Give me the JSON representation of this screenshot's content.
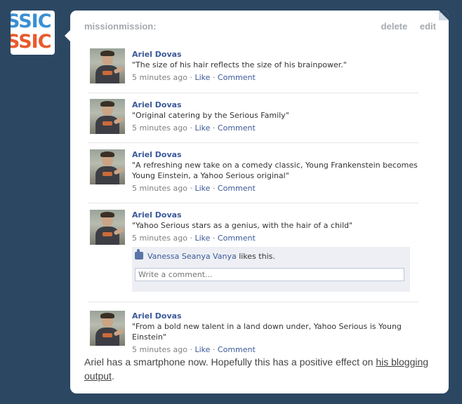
{
  "avatar": {
    "line1": "SSIC",
    "line2": "SSIC"
  },
  "post": {
    "username": "missionmission:",
    "delete_label": "delete",
    "edit_label": "edit"
  },
  "feed": [
    {
      "name": "Ariel Dovas",
      "text": "\"The size of his hair reflects the size of his brainpower.\"",
      "time": "5 minutes ago",
      "sep1": " · ",
      "like": "Like",
      "sep2": " · ",
      "comment": "Comment"
    },
    {
      "name": "Ariel Dovas",
      "text": "\"Original catering by the Serious Family\"",
      "time": "5 minutes ago",
      "sep1": " · ",
      "like": "Like",
      "sep2": " · ",
      "comment": "Comment"
    },
    {
      "name": "Ariel Dovas",
      "text": "\"A refreshing new take on a comedy classic, Young Frankenstein becomes Young Einstein, a Yahoo Serious original\"",
      "time": "5 minutes ago",
      "sep1": " · ",
      "like": "Like",
      "sep2": " · ",
      "comment": "Comment"
    },
    {
      "name": "Ariel Dovas",
      "text": "\"Yahoo Serious stars as a genius, with the hair of a child\"",
      "time": "5 minutes ago",
      "sep1": " · ",
      "like": "Like",
      "sep2": " · ",
      "comment": "Comment"
    },
    {
      "name": "Ariel Dovas",
      "text": "\"From a bold new talent in a land down under, Yahoo Serious is Young Einstein\"",
      "time": "5 minutes ago",
      "sep1": " · ",
      "like": "Like",
      "sep2": " · ",
      "comment": "Comment"
    }
  ],
  "likes": {
    "liker": "Vanessa Seanya Vanya",
    "suffix": " likes this.",
    "comment_placeholder": "Write a comment..."
  },
  "note": {
    "text": "Ariel has a smartphone now. Hopefully this has a positive effect on ",
    "link": "his blogging output",
    "end": "."
  }
}
